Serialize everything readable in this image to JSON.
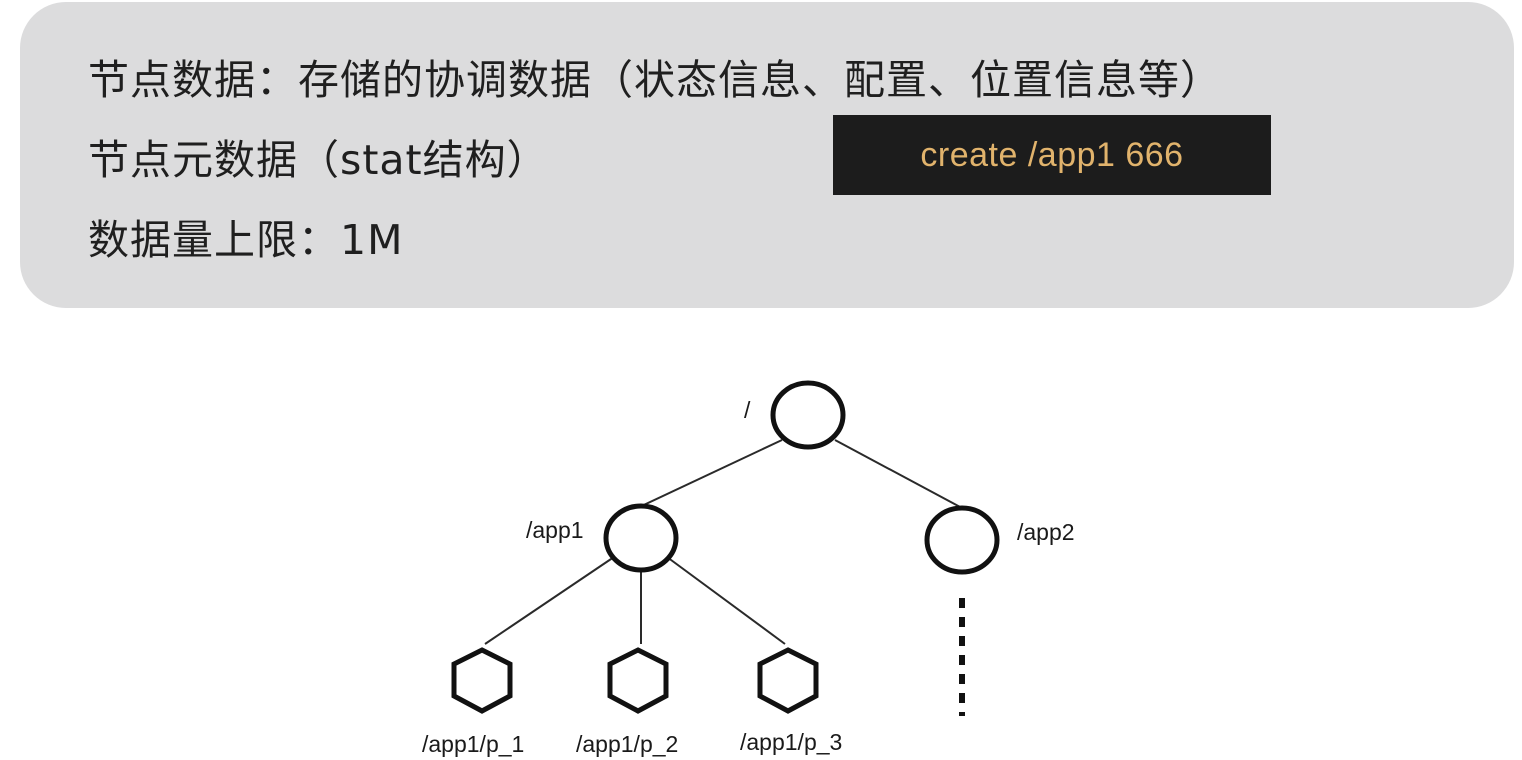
{
  "panel": {
    "lines": [
      "节点数据：存储的协调数据（状态信息、配置、位置信息等）",
      "节点元数据（stat结构）",
      "数据量上限：1M"
    ],
    "command": "create /app1 666"
  },
  "tree": {
    "root_label": "/",
    "app1_label": "/app1",
    "app2_label": "/app2",
    "child_labels": [
      "/app1/p_1",
      "/app1/p_2",
      "/app1/p_3"
    ]
  }
}
